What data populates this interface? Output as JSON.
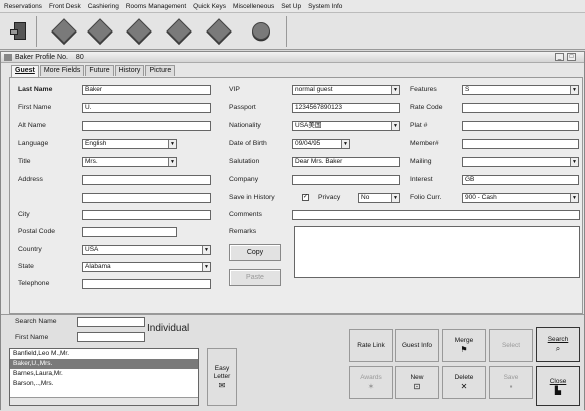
{
  "menu": [
    "Reservations",
    "Front Desk",
    "Cashiering",
    "Rooms Management",
    "Quick Keys",
    "Miscelleneous",
    "Set Up",
    "System Info"
  ],
  "window": {
    "title_label": "Baker Profile No.",
    "title_number": "80"
  },
  "tabs": [
    "Guest",
    "More Fields",
    "Future",
    "History",
    "Picture"
  ],
  "left": {
    "last_name_label": "Last Name",
    "last_name": "Baker",
    "first_name_label": "First Name",
    "first_name": "U.",
    "alt_name_label": "Alt Name",
    "alt_name": "",
    "language_label": "Language",
    "language": "English",
    "title_label": "Title",
    "title": "Mrs.",
    "address_label": "Address",
    "address1": "",
    "address2": "",
    "city_label": "City",
    "city": "",
    "postal_label": "Postal Code",
    "postal": "",
    "country_label": "Country",
    "country": "USA",
    "state_label": "State",
    "state": "Alabama",
    "telephone_label": "Telephone",
    "telephone": ""
  },
  "mid": {
    "vip_label": "VIP",
    "vip": "normal guest",
    "passport_label": "Passport",
    "passport": "1234567890123",
    "nationality_label": "Nationality",
    "nationality": "USA美国",
    "dob_label": "Date of Birth",
    "dob": "09/04/95",
    "salutation_label": "Salutation",
    "salutation": "Dear Mrs. Baker",
    "company_label": "Company",
    "company": "",
    "save_history_label": "Save in History",
    "privacy_label": "Privacy",
    "privacy": "No",
    "comments_label": "Comments",
    "comments": "",
    "remarks_label": "Remarks",
    "copy_label": "Copy",
    "paste_label": "Paste"
  },
  "right": {
    "features_label": "Features",
    "features": "S",
    "rate_code_label": "Rate Code",
    "rate_code": "",
    "plat_label": "Plat #",
    "plat": "",
    "member_label": "Member#",
    "member": "",
    "mailing_label": "Mailing",
    "mailing": "",
    "interest_label": "Interest",
    "interest": "GB",
    "folio_label": "Folio Curr.",
    "folio": "900 - Cash"
  },
  "search": {
    "search_name_label": "Search Name",
    "first_name_label": "First Name",
    "individual": "Individual",
    "results": [
      "Banfield,Leo M.,Mr.",
      "Baker,U.,Mrs.",
      "Barnes,Laura,Mr.",
      "Barson,..,Mrs."
    ],
    "selected_index": 1,
    "easy_letter": "Easy Letter"
  },
  "actions": {
    "rate_link": "Rate Link",
    "guest_info": "Guest Info",
    "merge": "Merge",
    "select": "Select",
    "search": "Search",
    "awards": "Awards",
    "new": "New",
    "delete": "Delete",
    "save": "Save",
    "close": "Close"
  }
}
